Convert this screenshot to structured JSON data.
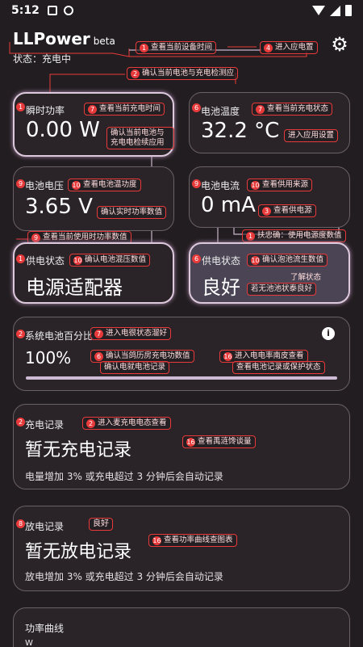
{
  "status_bar": {
    "time": "5:12"
  },
  "header": {
    "app_name": "LLPower",
    "beta": "beta",
    "state": "状态：充电中"
  },
  "cards": {
    "power": {
      "label": "瞬时功率",
      "value": "0.00 W"
    },
    "temperature": {
      "label": "电池温度",
      "value": "32.2 °C"
    },
    "voltage": {
      "label": "电池电压",
      "value": "3.65 V"
    },
    "current": {
      "label": "电池电流",
      "value": "0 mA"
    },
    "supply_status": {
      "label": "供电状态",
      "value": "电源适配器"
    },
    "battery_health": {
      "label": "供电状态",
      "value": "良好"
    },
    "battery_percent": {
      "label": "系统电池百分比",
      "value": "100%",
      "progress": 1.0
    },
    "charge_record": {
      "label": "充电记录",
      "value": "暂无充电记录",
      "note": "电量增加 3% 或充电超过 3 分钟后会自动记录"
    },
    "discharge_record": {
      "label": "放电记录",
      "value": "暂无放电记录",
      "note": "放电增加 3% 或充电超过 3 分钟后会自动记录"
    },
    "power_curve": {
      "label": "功率曲线",
      "unit": "W"
    }
  },
  "annotations": {
    "a1": {
      "num": "1",
      "text": "查看当前设备时间"
    },
    "a4": {
      "num": "4",
      "text": "进入应电置"
    },
    "a2": {
      "num": "2",
      "text": "确认当前电池与充电检测应"
    },
    "a7": {
      "num": "7",
      "text": "查看当前充电时间"
    },
    "a7b": {
      "num": "7",
      "text": "查看当前充电状态"
    },
    "confirm_battery": {
      "text": "确认当前电池与充电电检续应用"
    },
    "enter_settings": {
      "text": "进入应用设置"
    },
    "a10": {
      "num": "10",
      "text": "查看电池温功度"
    },
    "a10b": {
      "num": "10",
      "text": "查看供用来源"
    },
    "a3": {
      "num": "3",
      "text": "查看供电源"
    },
    "confirm_power": {
      "text": "确认实时功率数值"
    },
    "a1b": {
      "num": "1",
      "text": "扶忠确：使用电源度数值"
    },
    "a9": {
      "num": "9",
      "text": "查看当前使用时功率数值"
    },
    "a10c": {
      "num": "10",
      "text": "确认电池混压数值"
    },
    "a10d": {
      "num": "10",
      "text": "确认泡池流生数值"
    },
    "state_known": {
      "text": "了解状态"
    },
    "state_good": {
      "text": "若无池池状泰良好"
    },
    "a7c": {
      "num": "7",
      "text": "进入电很状态溜好"
    },
    "a6": {
      "num": "6",
      "text": "确认当鸽历房充电功数值"
    },
    "confirm_record": {
      "text": "确认电就电池记录"
    },
    "a16": {
      "num": "16",
      "text": "进入电电率南皮查看"
    },
    "view_record": {
      "text": "查看电池记录或保护状态"
    },
    "a2b": {
      "num": "2",
      "text": "进入麦充电电态查看"
    },
    "a16b": {
      "num": "16",
      "text": "查看禹涟馋谈量"
    },
    "good_tag": {
      "text": "良好"
    },
    "a16c": {
      "num": "16",
      "text": "查看功率曲线查图表"
    }
  }
}
